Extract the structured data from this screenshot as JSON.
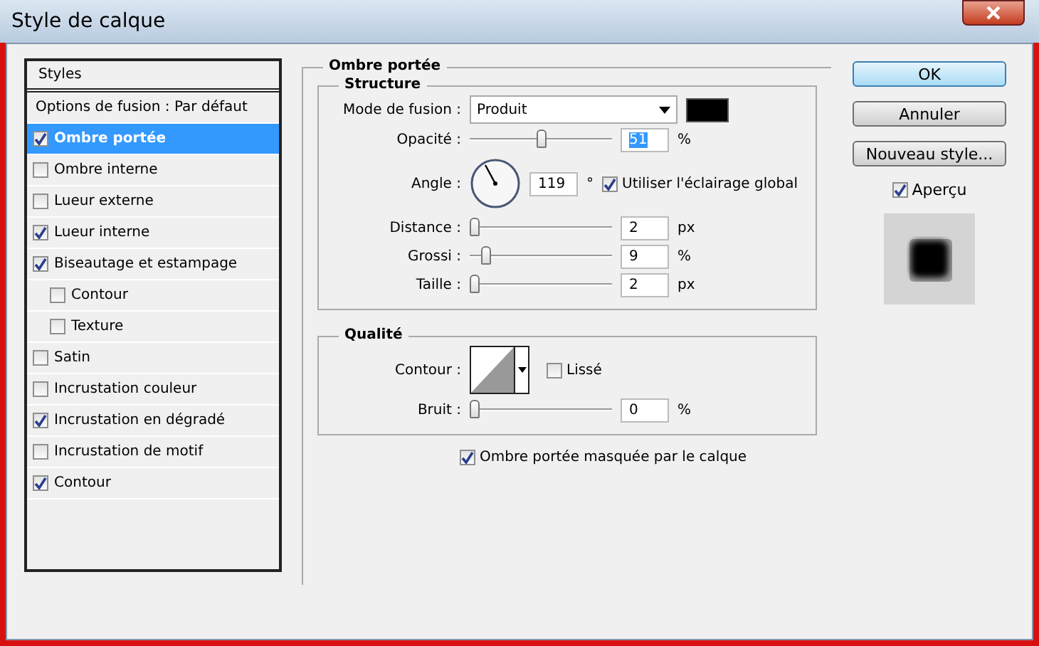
{
  "window": {
    "title": "Style de calque"
  },
  "styles_list": {
    "header": "Styles",
    "items": [
      {
        "label": "Options de fusion : Par défaut",
        "kind": "plain",
        "selected": false
      },
      {
        "label": "Ombre portée",
        "kind": "check",
        "checked": true,
        "selected": true
      },
      {
        "label": "Ombre interne",
        "kind": "check",
        "checked": false,
        "selected": false
      },
      {
        "label": "Lueur externe",
        "kind": "check",
        "checked": false,
        "selected": false
      },
      {
        "label": "Lueur interne",
        "kind": "check",
        "checked": true,
        "selected": false
      },
      {
        "label": "Biseautage et estampage",
        "kind": "check",
        "checked": true,
        "selected": false,
        "children": [
          {
            "label": "Contour",
            "kind": "check",
            "checked": false,
            "selected": false
          },
          {
            "label": "Texture",
            "kind": "check",
            "checked": false,
            "selected": false
          }
        ]
      },
      {
        "label": "Satin",
        "kind": "check",
        "checked": false,
        "selected": false
      },
      {
        "label": "Incrustation couleur",
        "kind": "check",
        "checked": false,
        "selected": false
      },
      {
        "label": "Incrustation en dégradé",
        "kind": "check",
        "checked": true,
        "selected": false
      },
      {
        "label": "Incrustation de motif",
        "kind": "check",
        "checked": false,
        "selected": false
      },
      {
        "label": "Contour",
        "kind": "check",
        "checked": true,
        "selected": false
      }
    ]
  },
  "panel": {
    "title": "Ombre portée",
    "structure": {
      "title": "Structure",
      "blend_mode": {
        "label": "Mode de fusion :",
        "value": "Produit",
        "color": "#000000"
      },
      "opacity": {
        "label": "Opacité :",
        "level": 0.51,
        "value": "51",
        "unit": "%",
        "value_selected": true
      },
      "angle": {
        "label": "Angle :",
        "value": "119",
        "unit": "°",
        "global_light": {
          "label": "Utiliser l'éclairage global",
          "checked": true
        }
      },
      "sliders": [
        {
          "label": "Distance :",
          "level": 0.0,
          "value": "2",
          "unit": "px"
        },
        {
          "label": "Grossi :",
          "level": 0.09,
          "value": "9",
          "unit": "%"
        },
        {
          "label": "Taille :",
          "level": 0.0,
          "value": "2",
          "unit": "px"
        }
      ]
    },
    "quality": {
      "title": "Qualité",
      "contour": {
        "label": "Contour :",
        "smooth": {
          "label": "Lissé",
          "checked": false
        }
      },
      "noise": {
        "label": "Bruit :",
        "level": 0.0,
        "value": "0",
        "unit": "%"
      }
    },
    "knockout": {
      "label": "Ombre portée masquée par le calque",
      "checked": true
    }
  },
  "buttons": [
    {
      "label": "OK",
      "default": true
    },
    {
      "label": "Annuler",
      "default": false
    },
    {
      "label": "Nouveau style...",
      "default": false
    }
  ],
  "preview": {
    "label": "Aperçu",
    "checked": true
  }
}
